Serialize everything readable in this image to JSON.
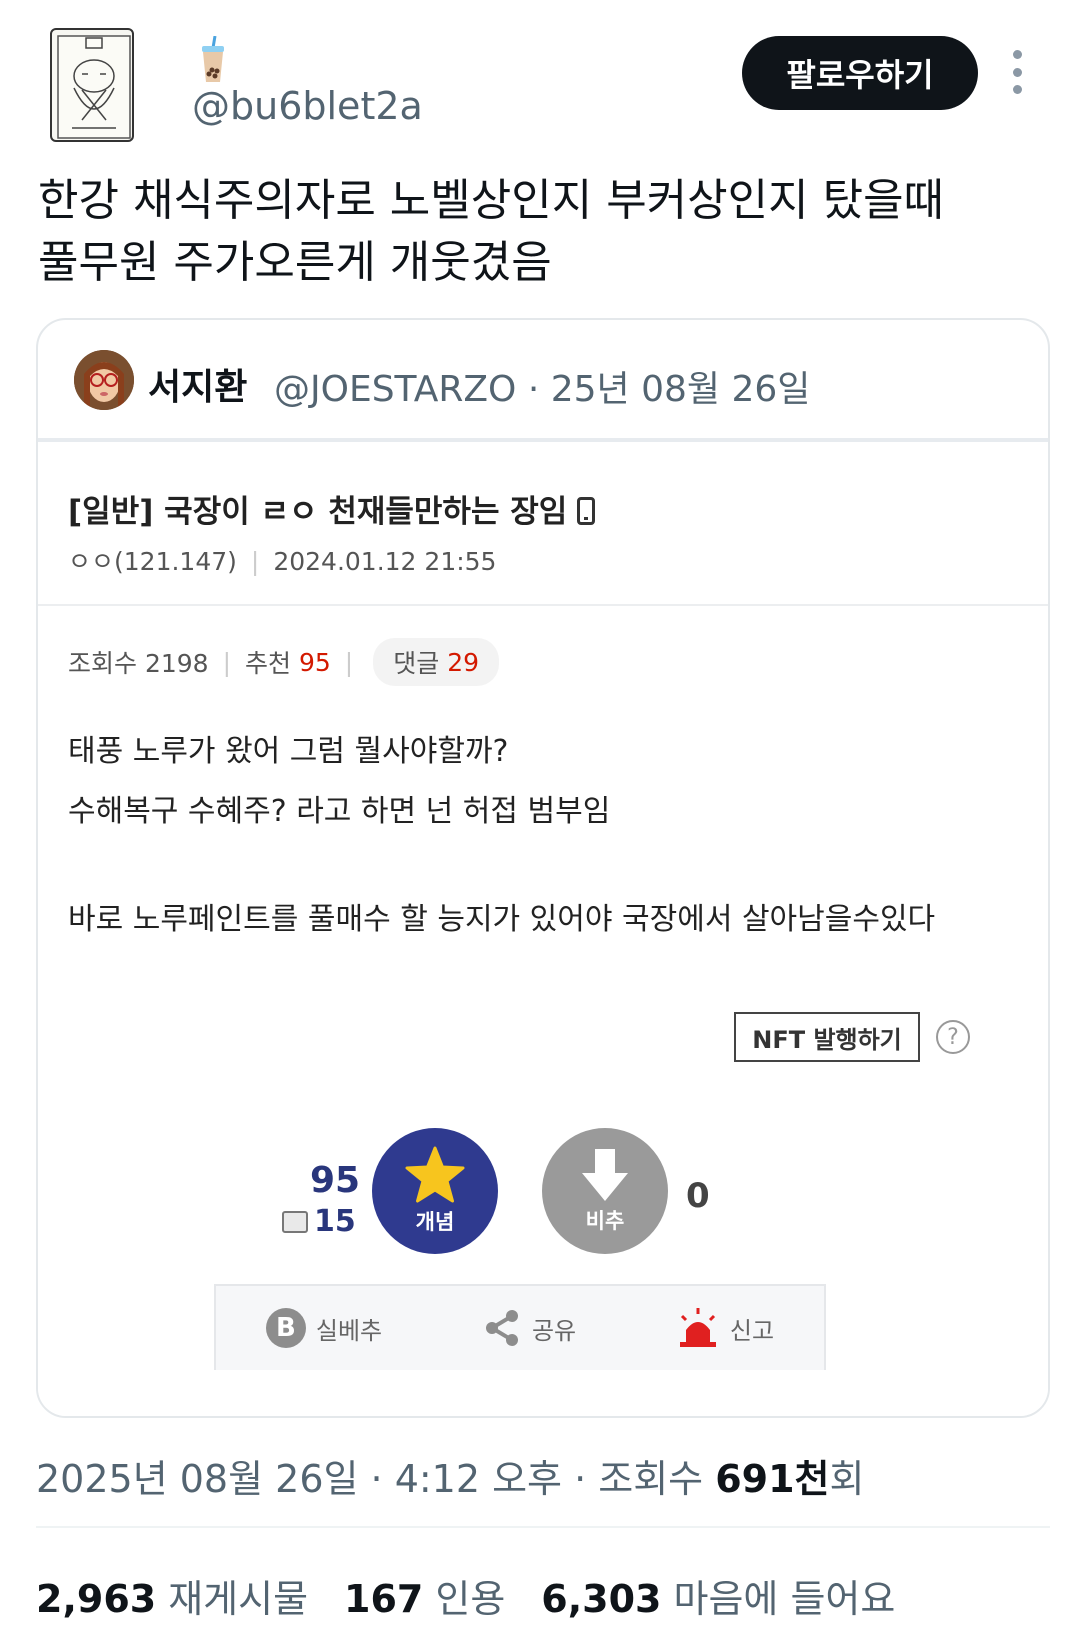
{
  "author": {
    "emoji": "bubble-tea",
    "handle": "@bu6blet2a"
  },
  "follow_button": "팔로우하기",
  "tweet_lines": [
    "한강 채식주의자로 노벨상인지 부커상인지 탔을때",
    "풀무원 주가오른게 개웃겼음"
  ],
  "quote": {
    "name": "서지환",
    "meta": "@JOESTARZO · 25년 08월 26일",
    "post": {
      "title": "[일반] 국장이 ㄹㅇ 천재들만하는 장임",
      "author": "ㅇㅇ(121.147)",
      "date": "2024.01.12 21:55",
      "views_label": "조회수 2198",
      "recommend_label": "추천",
      "recommend_value": "95",
      "comments_label": "댓글",
      "comments_value": "29",
      "body": [
        "태풍 노루가 왔어 그럼 뭘사야할까?",
        "수해복구 수혜주? 라고 하면 넌 허접 범부임",
        "바로 노루페인트를 풀매수 할 능지가 있어야 국장에서 살아남을수있다"
      ],
      "nft_button": "NFT 발행하기",
      "help": "?",
      "upvotes": "95",
      "fixed_upvotes": "15",
      "upvote_label": "개념",
      "downvote_label": "비추",
      "downvotes": "0",
      "actions": {
        "silbe": "실베추",
        "share": "공유",
        "report": "신고"
      }
    }
  },
  "timestamp": {
    "prefix": "2025년 08월 26일 · 4:12 오후 · 조회수 ",
    "views": "691천",
    "suffix": "회"
  },
  "engagement": {
    "retweets": "2,963",
    "retweets_label": "재게시물",
    "quotes": "167",
    "quotes_label": "인용",
    "likes": "6,303",
    "likes_label": "마음에 들어요"
  },
  "colors": {
    "follow_bg": "#0f1419",
    "upvote": "#2f3a8f",
    "downvote": "#9a9a9a",
    "report": "#e02020"
  }
}
